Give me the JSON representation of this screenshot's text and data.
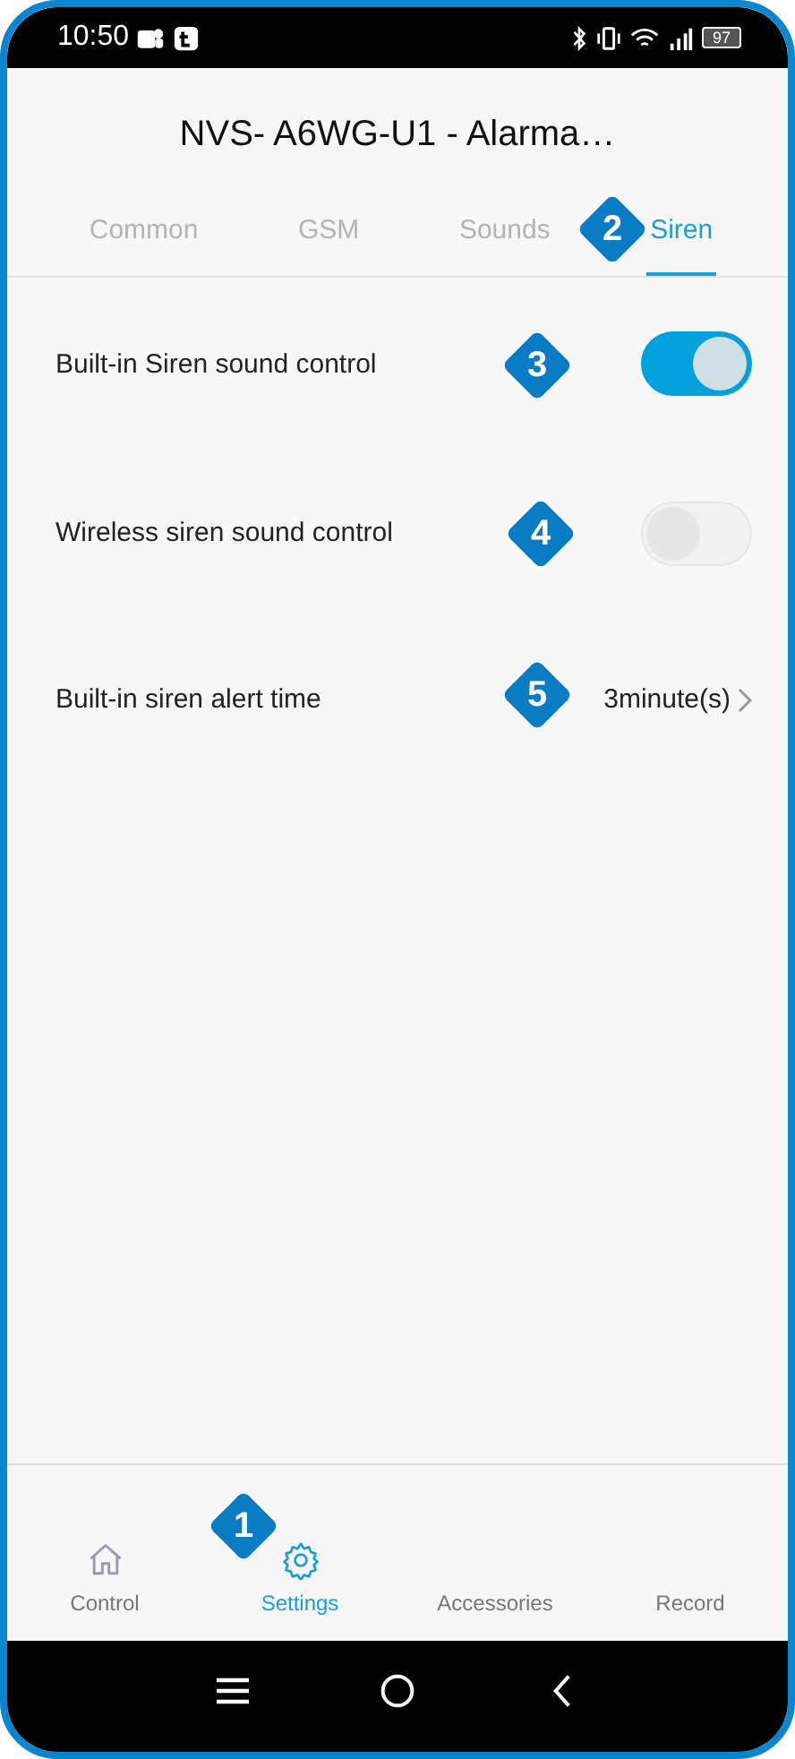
{
  "status_bar": {
    "time": "10:50",
    "battery": "97"
  },
  "header": {
    "title": "NVS- A6WG-U1 - Alarma…"
  },
  "tabs": [
    {
      "label": "Common",
      "selected": false
    },
    {
      "label": "GSM",
      "selected": false
    },
    {
      "label": "Sounds",
      "selected": false
    },
    {
      "label": "Siren",
      "selected": true
    }
  ],
  "settings": [
    {
      "kind": "toggle",
      "label": "Built-in Siren sound control",
      "on": true
    },
    {
      "kind": "toggle",
      "label": "Wireless siren sound control",
      "on": false
    },
    {
      "kind": "value",
      "label": "Built-in siren alert time",
      "value": "3minute(s)"
    }
  ],
  "bottom_nav": [
    {
      "label": "Control",
      "selected": false
    },
    {
      "label": "Settings",
      "selected": true
    },
    {
      "label": "Accessories",
      "selected": false
    },
    {
      "label": "Record",
      "selected": false
    }
  ],
  "callouts": [
    {
      "number": "1"
    },
    {
      "number": "2"
    },
    {
      "number": "3"
    },
    {
      "number": "4"
    },
    {
      "number": "5"
    }
  ]
}
